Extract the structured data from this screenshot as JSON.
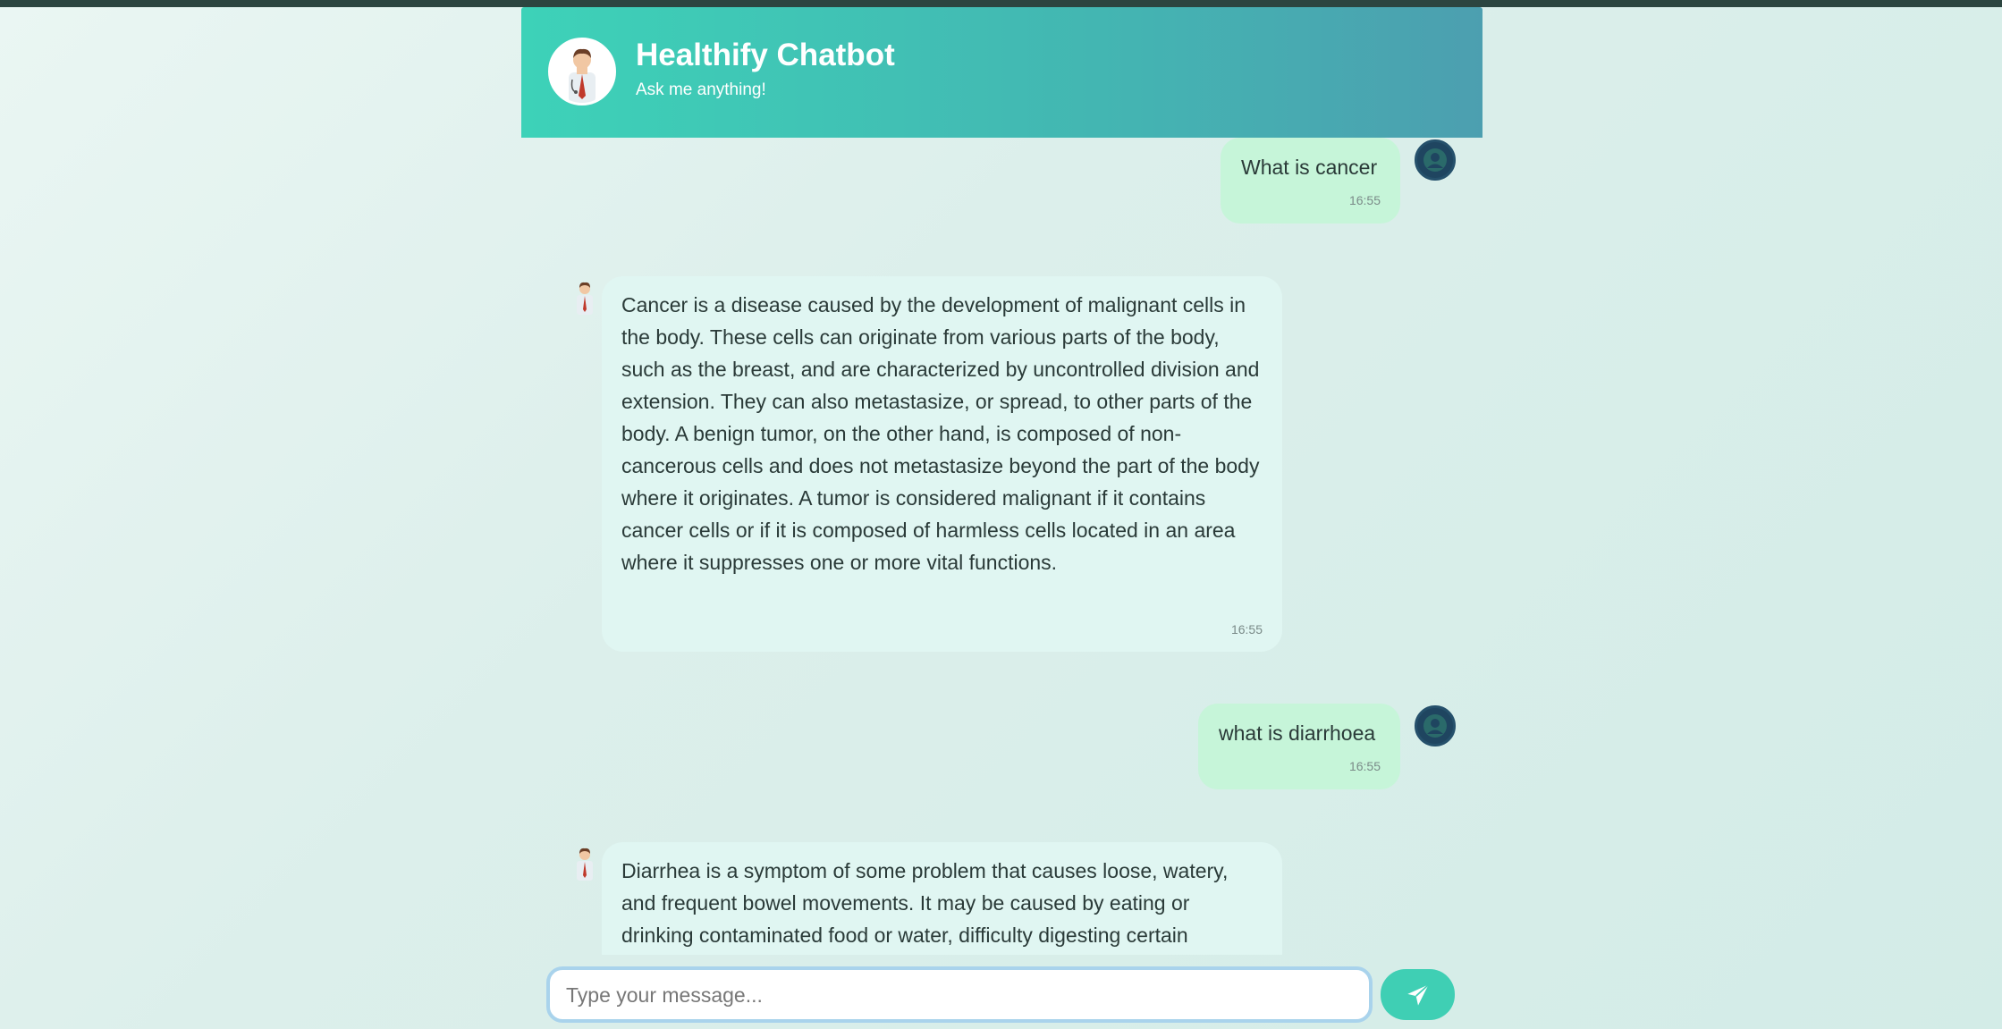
{
  "header": {
    "title": "Healthify Chatbot",
    "subtitle": "Ask me anything!"
  },
  "messages": [
    {
      "sender": "user",
      "text": "What is cancer",
      "time": "16:55"
    },
    {
      "sender": "bot",
      "text": "Cancer is a disease caused by the development of malignant cells in the body. These cells can originate from various parts of the body, such as the breast, and are characterized by uncontrolled division and extension. They can also metastasize, or spread, to other parts of the body. A benign tumor, on the other hand, is composed of non-cancerous cells and does not metastasize beyond the part of the body where it originates. A tumor is considered malignant if it contains cancer cells or if it is composed of harmless cells located in an area where it suppresses one or more vital functions.",
      "time": "16:55"
    },
    {
      "sender": "user",
      "text": "what is diarrhoea",
      "time": "16:55"
    },
    {
      "sender": "bot",
      "text": "Diarrhea is a symptom of some problem that causes loose, watery, and frequent bowel movements. It may be caused by eating or drinking contaminated food or water, difficulty digesting certain"
    }
  ],
  "input": {
    "placeholder": "Type your message..."
  },
  "icons": {
    "header_avatar": "doctor-avatar-icon",
    "bot_avatar": "doctor-icon",
    "user_avatar": "user-icon",
    "send": "send-arrow-icon"
  },
  "colors": {
    "header_start": "#3dd2b8",
    "header_end": "#4c9fb0",
    "user_bubble": "#c6f5d9",
    "bot_bubble": "#e0f6f2",
    "send_button": "#3fcfb4"
  }
}
